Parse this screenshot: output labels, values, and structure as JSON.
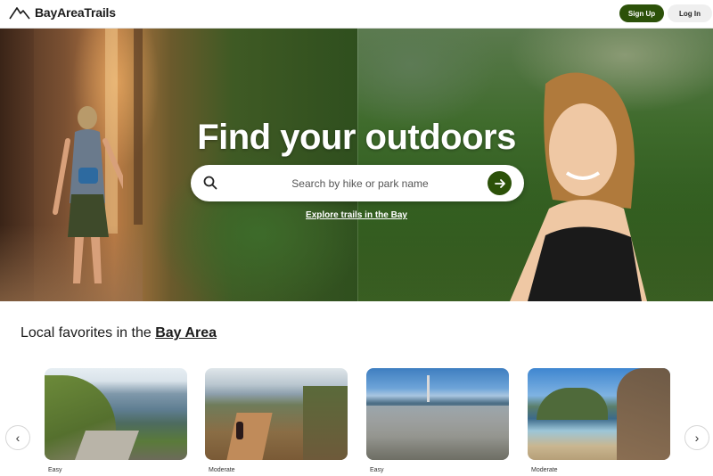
{
  "header": {
    "logo_text": "BayAreaTrails",
    "signup_label": "Sign Up",
    "login_label": "Log In"
  },
  "hero": {
    "title": "Find your outdoors",
    "search_placeholder": "Search by hike or park name",
    "explore_link": "Explore trails in the Bay"
  },
  "section": {
    "title_prefix": "Local favorites in the ",
    "title_link": "Bay Area"
  },
  "cards": [
    {
      "difficulty": "Easy"
    },
    {
      "difficulty": "Moderate"
    },
    {
      "difficulty": "Easy"
    },
    {
      "difficulty": "Moderate"
    }
  ],
  "carousel": {
    "prev_glyph": "‹",
    "next_glyph": "›"
  },
  "colors": {
    "brand": "#2c5109",
    "login_bg": "#efefef"
  }
}
